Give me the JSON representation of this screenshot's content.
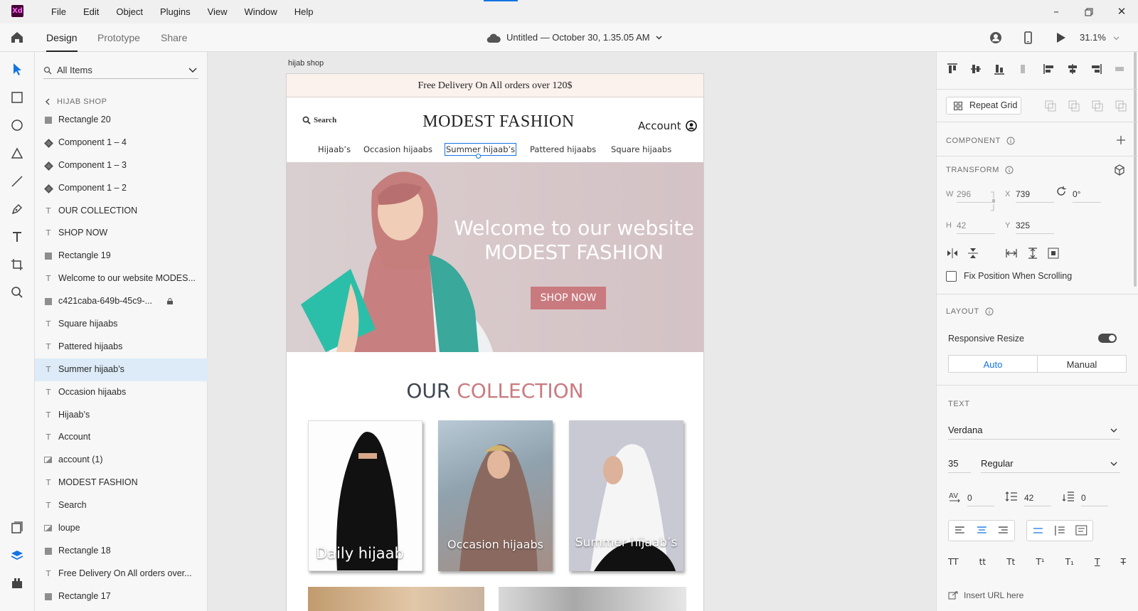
{
  "app": {
    "menu": [
      "File",
      "Edit",
      "Object",
      "Plugins",
      "View",
      "Window",
      "Help"
    ],
    "logo_text": "Xd",
    "window_controls": [
      "minimize-icon",
      "restore-icon",
      "close-icon"
    ]
  },
  "toolbar": {
    "tabs": [
      "Design",
      "Prototype",
      "Share"
    ],
    "active_tab": "Design",
    "doc_title": "Untitled — October 30, 1.35.05 AM",
    "zoom": "31.1%"
  },
  "layers": {
    "filter": "All Items",
    "breadcrumb": "HIJAB SHOP",
    "items": [
      {
        "label": "Rectangle 20",
        "kind": "rect"
      },
      {
        "label": "Component 1 – 4",
        "kind": "comp"
      },
      {
        "label": "Component 1 – 3",
        "kind": "comp"
      },
      {
        "label": "Component 1 – 2",
        "kind": "comp"
      },
      {
        "label": "OUR COLLECTION",
        "kind": "text"
      },
      {
        "label": "SHOP NOW",
        "kind": "text"
      },
      {
        "label": "Rectangle 19",
        "kind": "rect"
      },
      {
        "label": "Welcome to our website MODES...",
        "kind": "text"
      },
      {
        "label": "c421caba-649b-45c9-...",
        "kind": "rect",
        "locked": true
      },
      {
        "label": "Square hijaabs",
        "kind": "text"
      },
      {
        "label": "Pattered hijaabs",
        "kind": "text"
      },
      {
        "label": "Summer hijaab’s",
        "kind": "text",
        "selected": true
      },
      {
        "label": "Occasion hijaabs",
        "kind": "text"
      },
      {
        "label": "Hijaab’s",
        "kind": "text"
      },
      {
        "label": "Account",
        "kind": "text"
      },
      {
        "label": "account (1)",
        "kind": "img"
      },
      {
        "label": " MODEST FASHION",
        "kind": "text"
      },
      {
        "label": " Search",
        "kind": "text"
      },
      {
        "label": "loupe",
        "kind": "img"
      },
      {
        "label": "Rectangle 18",
        "kind": "rect"
      },
      {
        "label": "Free Delivery On All orders over...",
        "kind": "text"
      },
      {
        "label": "Rectangle 17",
        "kind": "rect"
      }
    ]
  },
  "artboard": {
    "label": "hijab shop",
    "banner": "Free Delivery On All orders over 120$",
    "search": "Search",
    "brand": "MODEST FASHION",
    "account": "Account",
    "nav": [
      "Hijaab’s",
      "Occasion hijaabs",
      "Summer hijaab’s",
      "Pattered hijaabs",
      "Square hijaabs"
    ],
    "hero_line1": "Welcome to our website",
    "hero_line2": "MODEST FASHION",
    "hero_button": "SHOP NOW",
    "collection_word1": "OUR",
    "collection_word2": "COLLECTION",
    "cards": [
      "Daily hijaab",
      "Occasion hijaabs",
      "Summer hijaab’s"
    ],
    "colors": {
      "banner_bg": "#fbf1ed",
      "accent": "#c97a7f",
      "hero_bg": "#d8c9cb"
    }
  },
  "properties": {
    "repeat_grid": "Repeat Grid",
    "component_title": "COMPONENT",
    "transform_title": "TRANSFORM",
    "w_label": "W",
    "w": "296",
    "x_label": "X",
    "x": "739",
    "h_label": "H",
    "h": "42",
    "y_label": "Y",
    "y": "325",
    "rotation": "0°",
    "fix_position": "Fix Position When Scrolling",
    "layout_title": "LAYOUT",
    "responsive_resize": "Responsive Resize",
    "responsive_on": true,
    "auto": "Auto",
    "manual": "Manual",
    "text_title": "TEXT",
    "font": "Verdana",
    "font_size": "35",
    "weight": "Regular",
    "char_spacing": "0",
    "line_spacing": "42",
    "para_spacing": "0",
    "case_buttons": [
      "TT",
      "tt",
      "Tt",
      "T¹",
      "T₁",
      "T",
      "T"
    ],
    "insert_url": "Insert URL here",
    "accent_color": "#1473e6"
  }
}
